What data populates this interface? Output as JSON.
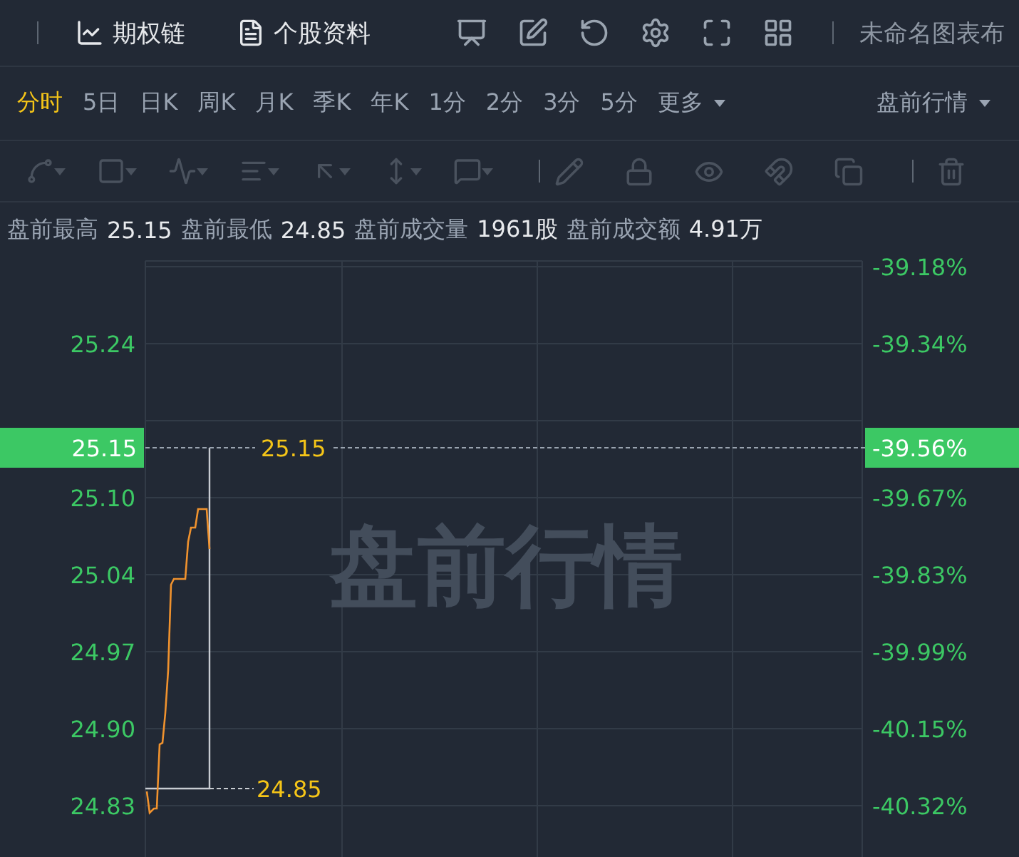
{
  "top_bar": {
    "links": [
      {
        "label": "期权链"
      },
      {
        "label": "个股资料"
      }
    ],
    "layout_name": "未命名图表布"
  },
  "periods": [
    {
      "label": "分时",
      "kind": "period",
      "selected": true
    },
    {
      "label": "5日",
      "kind": "period",
      "selected": false
    },
    {
      "label": "日K",
      "kind": "period",
      "selected": false
    },
    {
      "label": "周K",
      "kind": "period",
      "selected": false
    },
    {
      "label": "月K",
      "kind": "period",
      "selected": false
    },
    {
      "label": "季K",
      "kind": "period",
      "selected": false
    },
    {
      "label": "年K",
      "kind": "period",
      "selected": false
    },
    {
      "label": "1分",
      "kind": "period",
      "selected": false
    },
    {
      "label": "2分",
      "kind": "period",
      "selected": false
    },
    {
      "label": "3分",
      "kind": "period",
      "selected": false
    },
    {
      "label": "5分",
      "kind": "period",
      "selected": false
    },
    {
      "label": "更多",
      "kind": "dropdown",
      "selected": false
    }
  ],
  "session_menu": {
    "label": "盘前行情"
  },
  "stats": [
    {
      "label": "盘前最高",
      "value": "25.15"
    },
    {
      "label": "盘前最低",
      "value": "24.85"
    },
    {
      "label": "盘前成交量",
      "value": "1961股"
    },
    {
      "label": "盘前成交额",
      "value": "4.91万"
    }
  ],
  "chart": {
    "watermark": "盘前行情",
    "price_axis": [
      "25.24",
      "25.10",
      "25.04",
      "24.97",
      "24.90",
      "24.83"
    ],
    "right_axis": [
      "-39.18%",
      "-39.34%",
      "-39.67%",
      "-39.83%",
      "-39.99%",
      "-40.15%",
      "-40.32%"
    ],
    "high_label": "25.15",
    "low_label": "24.85",
    "current_tag": {
      "price": "25.15",
      "percent": "-39.56%"
    }
  }
}
